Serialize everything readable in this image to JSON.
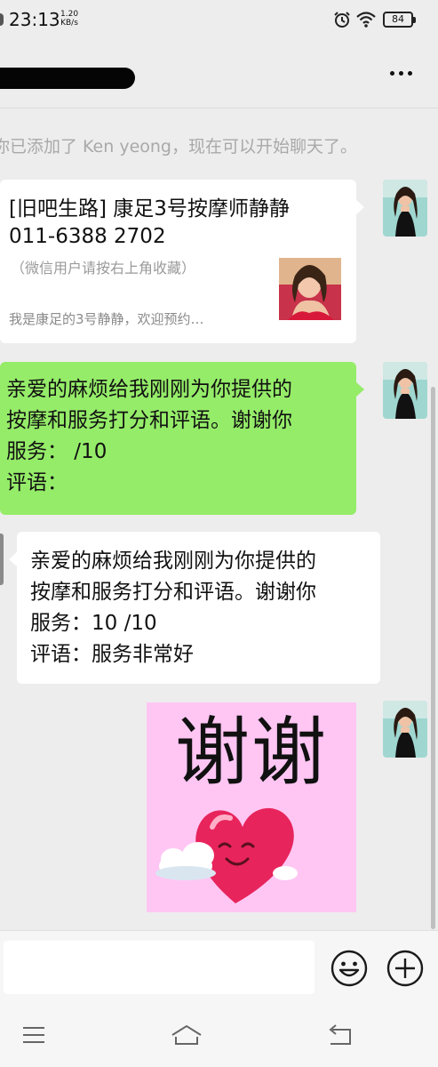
{
  "status_bar": {
    "time": "23:13",
    "speed_value": "1.20",
    "speed_unit": "KB/s",
    "battery": "84",
    "icons": [
      "alarm-icon",
      "wifi-icon",
      "battery-icon"
    ]
  },
  "header": {
    "title": "",
    "title_redacted": true,
    "more_icon": "more-icon"
  },
  "system_message": "你已添加了 Ken yeong，现在可以开始聊天了。",
  "messages": [
    {
      "type": "card",
      "side": "right",
      "title": "[旧吧生路] 康足3号按摩师静静 011-6388 2702",
      "note": "（微信用户请按右上角收藏）",
      "description": "我是康足的3号静静，欢迎预约…"
    },
    {
      "type": "text",
      "side": "right",
      "lines": [
        "亲爱的麻烦给我刚刚为你提供的",
        "按摩和服务打分和评语。谢谢你",
        "服务：   /10",
        "评语："
      ]
    },
    {
      "type": "text",
      "side": "left",
      "lines": [
        "亲爱的麻烦给我刚刚为你提供的",
        "按摩和服务打分和评语。谢谢你",
        "服务：10 /10",
        "评语：服务非常好"
      ]
    },
    {
      "type": "sticker",
      "side": "right",
      "text": "谢谢"
    }
  ],
  "input_bar": {
    "placeholder": "",
    "emoji_icon": "emoji-icon",
    "plus_icon": "plus-icon"
  },
  "nav_bar": {
    "icons": [
      "menu-icon",
      "home-icon",
      "back-icon"
    ]
  },
  "colors": {
    "background": "#ededed",
    "bubble_sent": "#95ec69",
    "bubble_received": "#ffffff",
    "system_text": "#a9a9a9",
    "sticker_bg": "#ffc6f4"
  }
}
